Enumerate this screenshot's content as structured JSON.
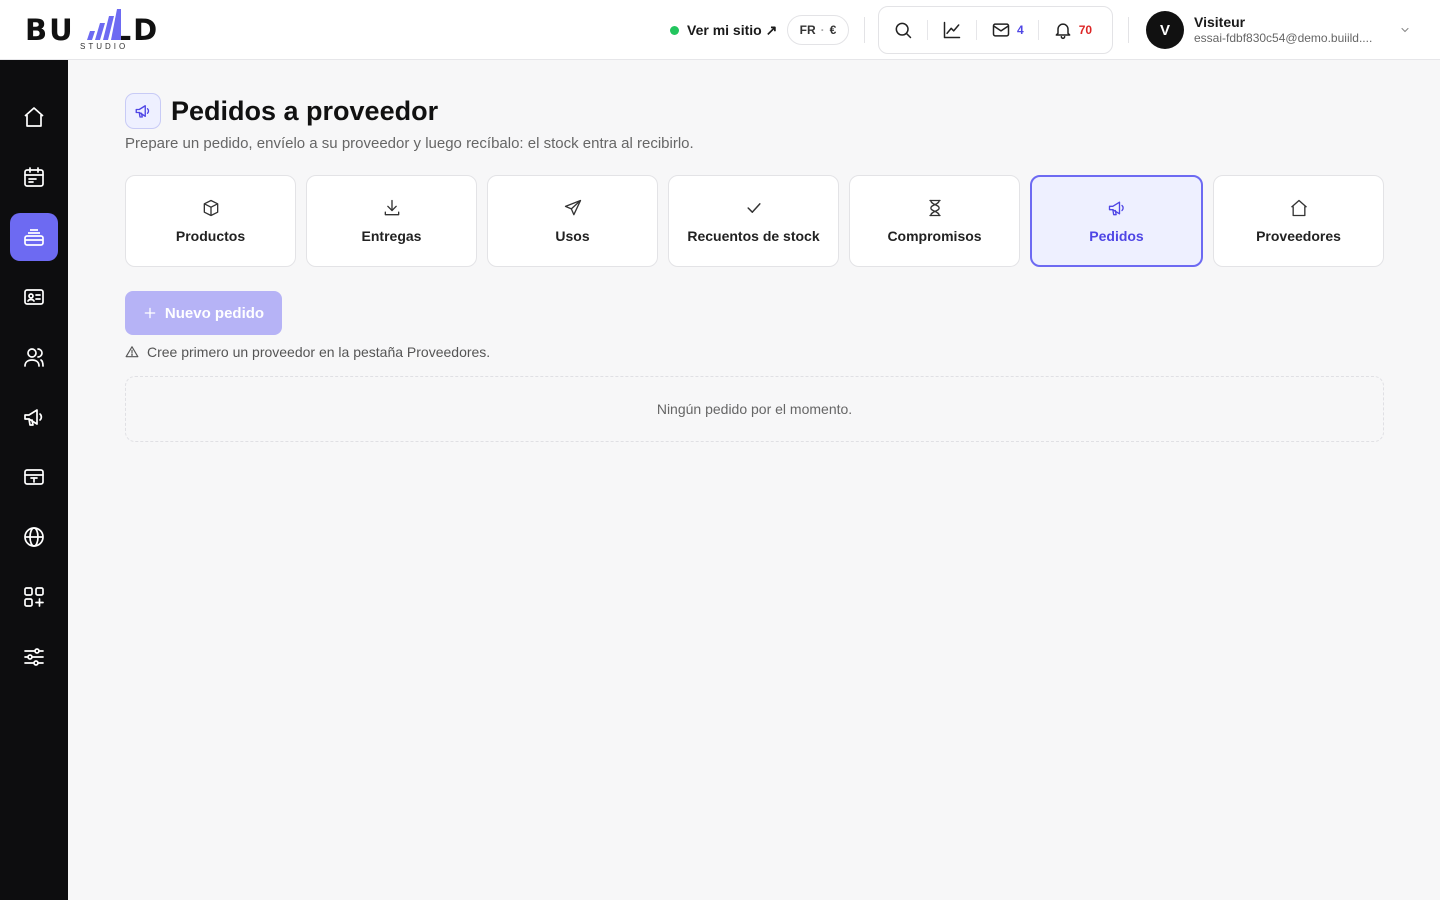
{
  "brand": {
    "word_left": "BU",
    "word_right": "LD",
    "sub": "STUDIO",
    "accent": "#6d6af2"
  },
  "header": {
    "site_link": "Ver mi sitio ↗",
    "site_status_color": "#22c55e",
    "lang": "FR",
    "lang_sep": "·",
    "currency": "€",
    "tools": {
      "search_icon": "search-icon",
      "analytics_icon": "chart-line-icon",
      "mail_count": "4",
      "notifications_count": "70"
    },
    "user": {
      "initial": "V",
      "name": "Visiteur",
      "email": "essai-fdbf830c54@demo.buiild...."
    }
  },
  "sidebar": {
    "items": [
      {
        "name": "home",
        "icon": "home-icon",
        "active": false
      },
      {
        "name": "calendar",
        "icon": "calendar-icon",
        "active": false
      },
      {
        "name": "inventory",
        "icon": "inbox-stack-icon",
        "active": true
      },
      {
        "name": "contacts",
        "icon": "id-card-icon",
        "active": false
      },
      {
        "name": "users",
        "icon": "users-icon",
        "active": false
      },
      {
        "name": "marketing",
        "icon": "megaphone-icon",
        "active": false
      },
      {
        "name": "payments",
        "icon": "register-icon",
        "active": false
      },
      {
        "name": "website",
        "icon": "globe-icon",
        "active": false
      },
      {
        "name": "apps",
        "icon": "apps-plus-icon",
        "active": false
      },
      {
        "name": "settings",
        "icon": "sliders-icon",
        "active": false
      }
    ]
  },
  "main": {
    "title": "Pedidos a proveedor",
    "subtitle": "Prepare un pedido, envíelo a su proveedor y luego recíbalo: el stock entra al recibirlo.",
    "tabs": [
      {
        "label": "Productos",
        "icon": "box-icon",
        "active": false
      },
      {
        "label": "Entregas",
        "icon": "download-icon",
        "active": false
      },
      {
        "label": "Usos",
        "icon": "send-icon",
        "active": false
      },
      {
        "label": "Recuentos de stock",
        "icon": "check-icon",
        "active": false
      },
      {
        "label": "Compromisos",
        "icon": "hourglass-icon",
        "active": false
      },
      {
        "label": "Pedidos",
        "icon": "megaphone-icon",
        "active": true
      },
      {
        "label": "Proveedores",
        "icon": "house-icon",
        "active": false
      }
    ],
    "new_button": "Nuevo pedido",
    "warning": "Cree primero un proveedor en la pestaña Proveedores.",
    "empty_state": "Ningún pedido por el momento."
  }
}
